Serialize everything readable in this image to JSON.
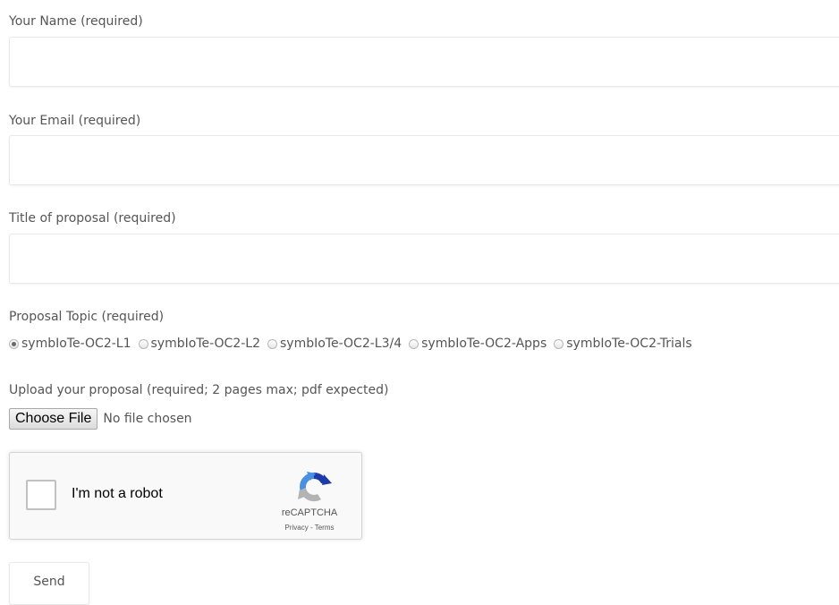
{
  "form": {
    "name": {
      "label": "Your Name (required)",
      "value": ""
    },
    "email": {
      "label": "Your Email (required)",
      "value": ""
    },
    "title": {
      "label": "Title of proposal (required)",
      "value": ""
    },
    "topic": {
      "label": "Proposal Topic (required)",
      "selected": "symbIoTe-OC2-L1",
      "options": [
        "symbIoTe-OC2-L1",
        "symbIoTe-OC2-L2",
        "symbIoTe-OC2-L3/4",
        "symbIoTe-OC2-Apps",
        "symbIoTe-OC2-Trials"
      ]
    },
    "upload": {
      "label": "Upload your proposal (required; 2 pages max; pdf expected)",
      "button_label": "Choose File",
      "status": "No file chosen"
    },
    "recaptcha": {
      "checkbox_label": "I'm not a robot",
      "brand": "reCAPTCHA",
      "privacy": "Privacy",
      "separator": " - ",
      "terms": "Terms",
      "checked": false,
      "logo_icon": "recaptcha-logo-icon",
      "colors": {
        "blue": "#1c3aa9",
        "light_blue": "#4a90e2",
        "gray": "#b3b3b3"
      }
    },
    "send_label": "Send"
  },
  "colors": {
    "text": "#555555",
    "input_border": "#e8e8e8",
    "background": "#ffffff"
  }
}
